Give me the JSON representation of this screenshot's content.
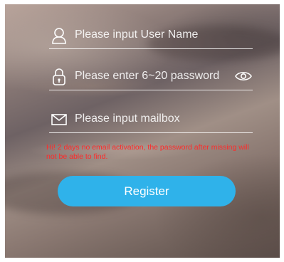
{
  "form": {
    "username_placeholder": "Please input User Name",
    "password_placeholder": "Please enter 6~20 password",
    "email_placeholder": "Please input mailbox",
    "notice": "Hi! 2 days no email activation, the password after missing will not be able to find."
  },
  "register_button": {
    "label": "Register"
  },
  "icons": {
    "username": "user-icon",
    "password": "lock-icon",
    "email": "envelope-icon",
    "visibility": "eye-icon"
  },
  "colors": {
    "button": "#2fb2ea",
    "notice_text": "#ff2a2a",
    "field_text": "#ffffff"
  }
}
